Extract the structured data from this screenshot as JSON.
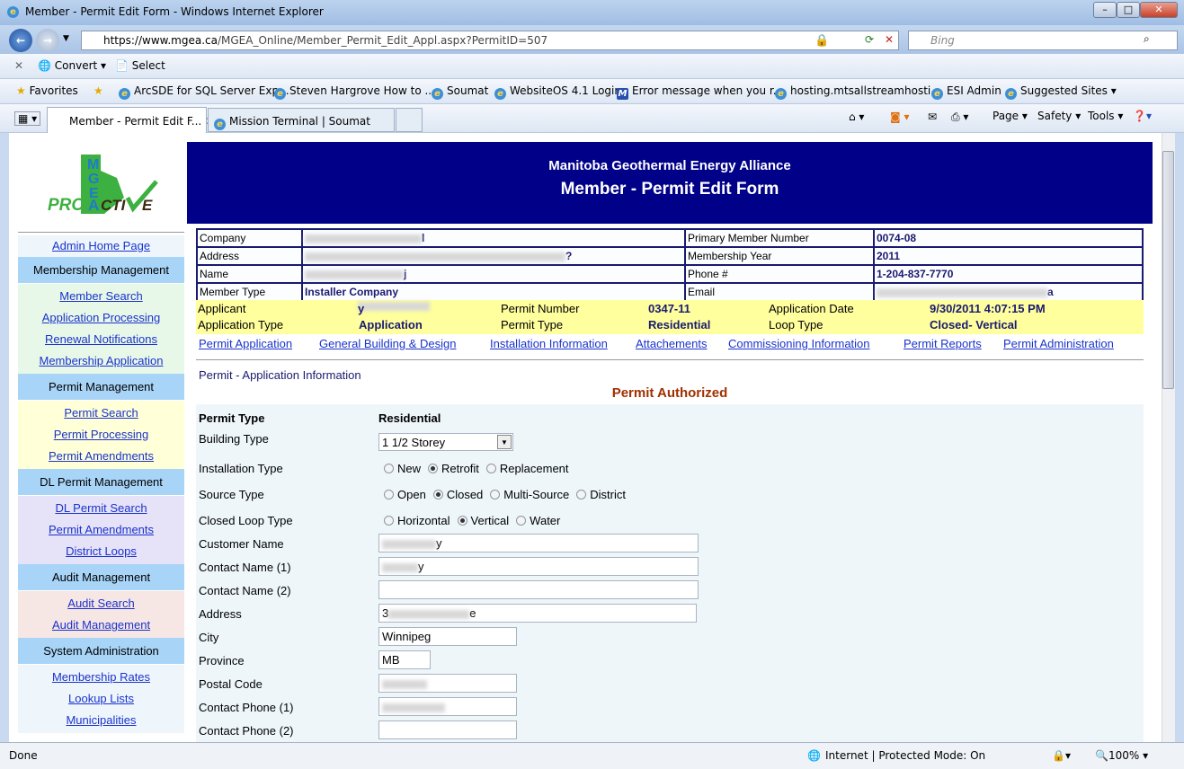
{
  "browser": {
    "title": "Member - Permit Edit Form - Windows Internet Explorer",
    "url_host": "https://www.mgea.ca",
    "url_path": "/MGEA_Online/Member_Permit_Edit_Appl.aspx?PermitID=507",
    "search_placeholder": "Bing",
    "toolbar": {
      "convert": "Convert",
      "select": "Select"
    },
    "favorites_label": "Favorites",
    "favorites": [
      "ArcSDE for SQL Server Exp...",
      "Steven Hargrove  How to ...",
      "Soumat",
      "WebsiteOS 4.1 Login",
      "Error message when you r...",
      "hosting.mtsallstreamhosti...",
      "ESI Admin",
      "Suggested Sites ▾"
    ],
    "tabs": [
      {
        "label": "Member - Permit Edit F...",
        "active": true
      },
      {
        "label": "Mission Terminal | Soumat",
        "active": false
      }
    ],
    "commands": {
      "page": "Page ▾",
      "safety": "Safety ▾",
      "tools": "Tools ▾"
    },
    "status": {
      "left": "Done",
      "zone": "Internet | Protected Mode: On",
      "zoom": "100%"
    }
  },
  "sidebar": {
    "logo_text": "MGEA PROACTIVE",
    "home": "Admin Home Page",
    "sections": [
      {
        "title": "Membership Management",
        "bg": "#e8f8e8",
        "items": [
          "Member Search",
          "Application Processing",
          "Renewal Notifications",
          "Membership Application"
        ]
      },
      {
        "title": "Permit Management",
        "bg": "#ffffd8",
        "items": [
          "Permit Search",
          "Permit Processing",
          "Permit Amendments"
        ]
      },
      {
        "title": "DL Permit Management",
        "bg": "#e6e2f8",
        "items": [
          "DL Permit Search",
          "Permit Amendments",
          "District Loops"
        ]
      },
      {
        "title": "Audit Management",
        "bg": "#f6e6e4",
        "items": [
          "Audit Search",
          "Audit Management"
        ]
      },
      {
        "title": "System Administration",
        "bg": "#eef6fc",
        "items": [
          "Membership Rates",
          "Lookup Lists",
          "Municipalities"
        ]
      }
    ]
  },
  "header": {
    "org": "Manitoba Geothermal Energy Alliance",
    "title": "Member - Permit Edit Form"
  },
  "member": {
    "company_label": "Company",
    "company_tail": "l",
    "address_label": "Address",
    "address_tail": "?",
    "name_label": "Name",
    "name_tail": "j",
    "member_type_label": "Member Type",
    "member_type": "Installer Company",
    "primary_member_number_label": "Primary Member Number",
    "primary_member_number": "0074-08",
    "membership_year_label": "Membership Year",
    "membership_year": "2011",
    "phone_label": "Phone #",
    "phone": "1-204-837-7770",
    "email_label": "Email",
    "email_tail": "a"
  },
  "permit_summary": {
    "applicant_label": "Applicant",
    "applicant_tail": "y",
    "permit_number_label": "Permit Number",
    "permit_number": "0347-11",
    "application_date_label": "Application Date",
    "application_date": "9/30/2011 4:07:15 PM",
    "application_type_label": "Application Type",
    "application_type": "Application",
    "permit_type_label": "Permit Type",
    "permit_type": "Residential",
    "loop_type_label": "Loop Type",
    "loop_type": "Closed- Vertical"
  },
  "permit_tabs": [
    "Permit Application",
    "General Building & Design",
    "Installation Information",
    "Attachements",
    "Commissioning Information",
    "Permit Reports",
    "Permit Administration"
  ],
  "form": {
    "section_title": "Permit - Application Information",
    "status": "Permit Authorized",
    "permit_type_label": "Permit Type",
    "permit_type": "Residential",
    "building_type_label": "Building Type",
    "building_type": "1 1/2 Storey",
    "installation_type_label": "Installation Type",
    "installation_options": [
      "New",
      "Retrofit",
      "Replacement"
    ],
    "installation_selected": "Retrofit",
    "source_type_label": "Source Type",
    "source_options": [
      "Open",
      "Closed",
      "Multi-Source",
      "District"
    ],
    "source_selected": "Closed",
    "closed_loop_label": "Closed Loop Type",
    "closed_loop_options": [
      "Horizontal",
      "Vertical",
      "Water"
    ],
    "closed_loop_selected": "Vertical",
    "customer_name_label": "Customer Name",
    "customer_name_tail": "y",
    "contact_name1_label": "Contact Name (1)",
    "contact_name1_tail": "y",
    "contact_name2_label": "Contact Name (2)",
    "contact_name2": "",
    "address_label": "Address",
    "address_head": "3",
    "address_tail": "e",
    "city_label": "City",
    "city": "Winnipeg",
    "province_label": "Province",
    "province": "MB",
    "postal_code_label": "Postal Code",
    "contact_phone1_label": "Contact Phone (1)",
    "contact_phone2_label": "Contact Phone (2)",
    "contact_phone2": ""
  }
}
